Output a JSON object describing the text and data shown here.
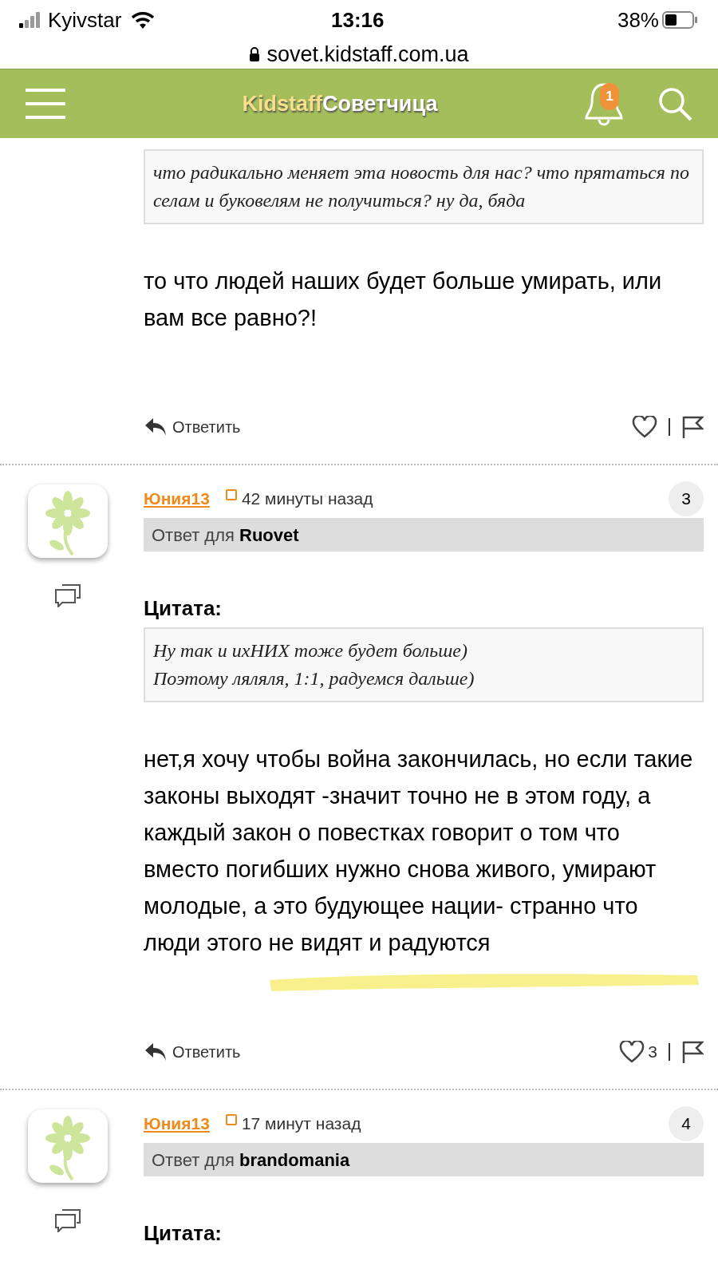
{
  "status_bar": {
    "carrier": "Kyivstar",
    "time": "13:16",
    "battery": "38%"
  },
  "url_bar": {
    "url": "sovet.kidstaff.com.ua"
  },
  "header": {
    "logo_part_1": "Kidstaff",
    "logo_part_2": "Советчица",
    "notification_count": "1"
  },
  "posts": [
    {
      "quote": "что радикально меняет эта новость для нас? что прятаться по селам и буковелям не получиться? ну да, бяда",
      "text": "то что людей наших будет больше умирать, или вам все равно?!",
      "highlighted": false,
      "reply_label": "Ответить"
    },
    {
      "number": "3",
      "author": "Юния13",
      "time": "42 минуты назад",
      "reply_to": "Ответ для **Ruovet**",
      "quote_title": "Цитата:",
      "quote": "Ну так и ихНИХ тоже будет больше)\nПоэтому ляляля, 1:1, радуемся дальше)",
      "text": "нет,я хочу чтобы война закончилась, но если такие законы выходят -значит точно не в этом году, а каждый закон о повестках говорит о том что вместо погибших нужно снова живого, умирают молодые, а это будующее нации- странно что люди этого не видят и радуются",
      "highlighted": true,
      "reply_label": "Ответить",
      "likes": "3"
    },
    {
      "number": "4",
      "author": "Юния13",
      "time": "17 минут назад",
      "reply_to": "Ответ для **brandomania**",
      "quote_title": "Цитата:"
    }
  ]
}
